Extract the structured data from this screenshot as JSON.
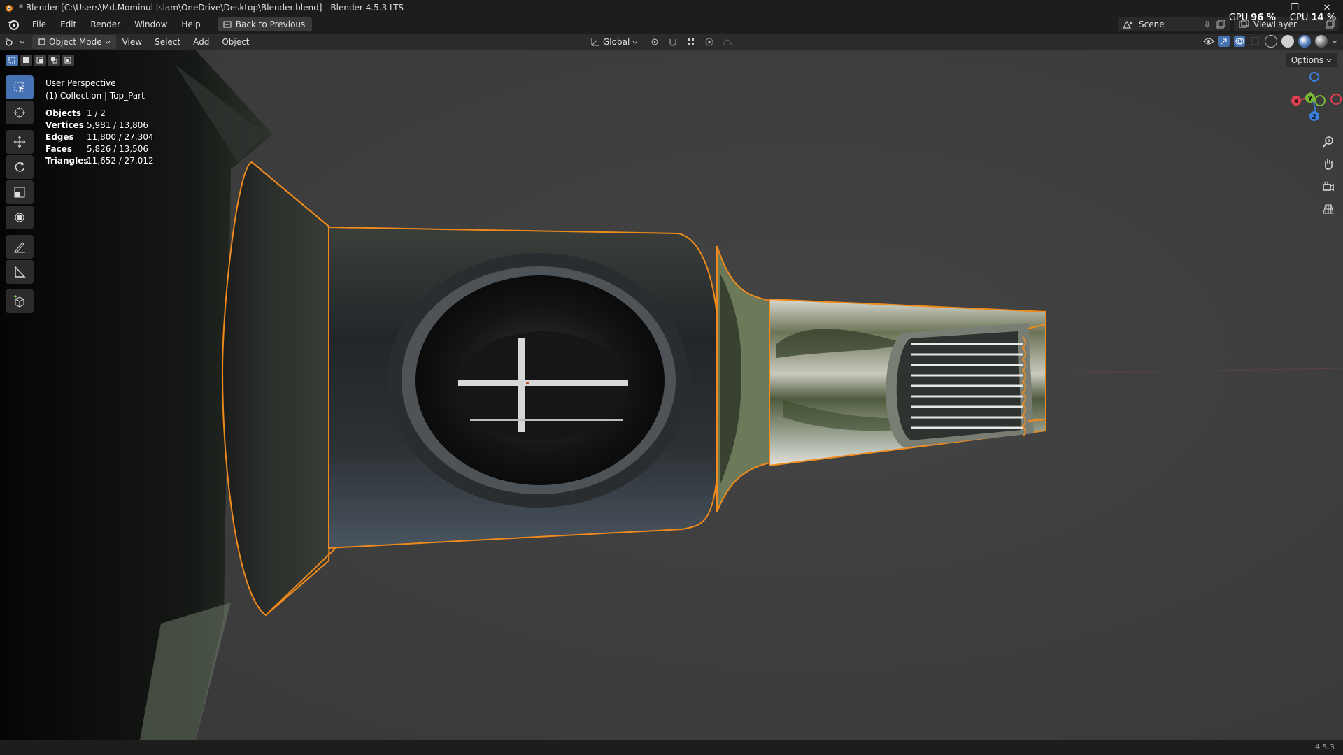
{
  "window": {
    "title": "* Blender [C:\\Users\\Md.Mominul Islam\\OneDrive\\Desktop\\Blender.blend] - Blender 4.5.3 LTS",
    "minimize": "–",
    "maximize": "❐",
    "close": "✕"
  },
  "menubar": {
    "items": [
      "File",
      "Edit",
      "Render",
      "Window",
      "Help"
    ],
    "back_button": "Back to Previous",
    "scene": "Scene",
    "view_layer": "ViewLayer"
  },
  "system": {
    "gpu_label": "GPU",
    "gpu_value": "96 %",
    "cpu_label": "CPU",
    "cpu_value": "14 %"
  },
  "header": {
    "mode": "Object Mode",
    "menus": [
      "View",
      "Select",
      "Add",
      "Object"
    ],
    "transform_orientation": "Global"
  },
  "viewport": {
    "options_label": "Options",
    "view_name": "User Perspective",
    "collection": "(1) Collection | Top_Part",
    "stats": [
      {
        "label": "Objects",
        "value": "1 / 2"
      },
      {
        "label": "Vertices",
        "value": "5,981 / 13,806"
      },
      {
        "label": "Edges",
        "value": "11,800 / 27,304"
      },
      {
        "label": "Faces",
        "value": "5,826 / 13,506"
      },
      {
        "label": "Triangles",
        "value": "11,652 / 27,012"
      }
    ],
    "gizmo": {
      "x": "X",
      "y": "Y",
      "z": "Z"
    }
  },
  "statusbar": {
    "version": "4.5.3"
  },
  "colors": {
    "accent_blue": "#4772b3",
    "selection_outline": "#f08a1c",
    "axis_x": "#e0404f",
    "axis_y": "#7ab83a",
    "axis_z": "#3a7fe0"
  }
}
